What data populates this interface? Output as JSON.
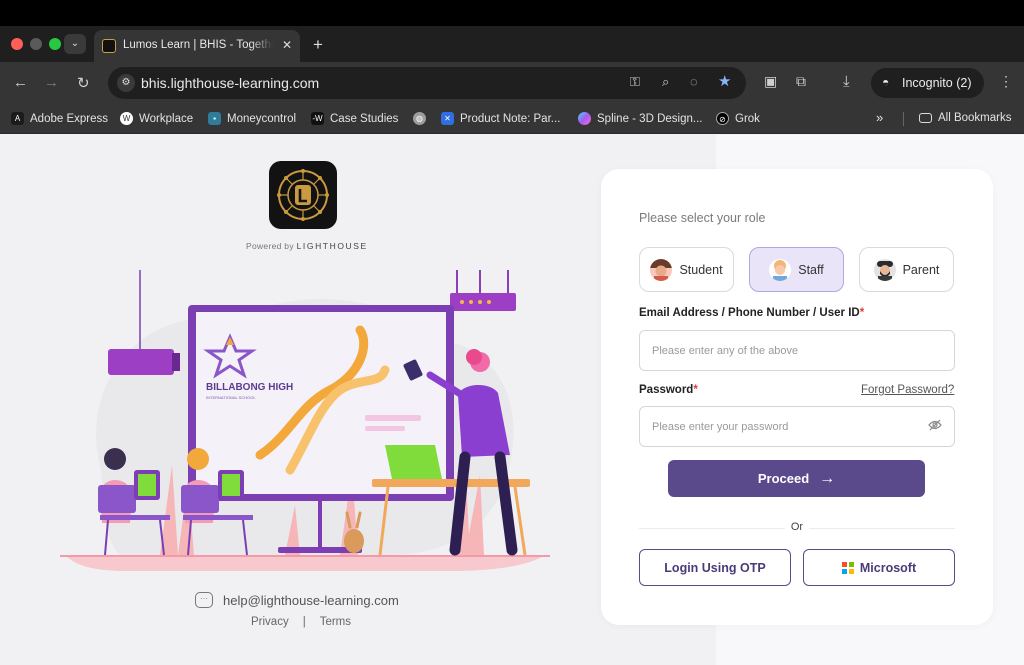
{
  "browser": {
    "tab_title": "Lumos Learn | BHIS - Together",
    "tab_close": "✕",
    "new_tab": "+",
    "url": "bhis.lighthouse-learning.com",
    "incognito_label": "Incognito (2)",
    "bookmarks": [
      {
        "label": "Adobe Express",
        "icon": "adobe-express-icon",
        "color": "#1b1b1b"
      },
      {
        "label": "Workplace",
        "icon": "workplace-icon",
        "color": "#ffffff"
      },
      {
        "label": "Moneycontrol",
        "icon": "moneycontrol-icon",
        "color": "#2e7d9a"
      },
      {
        "label": "Case Studies",
        "icon": "case-studies-icon",
        "color": "#111111"
      },
      {
        "label": "",
        "icon": "globe-icon",
        "color": "#9e9e9e"
      },
      {
        "label": "Product Note: Par...",
        "icon": "confluence-icon",
        "color": "#2f6fe4"
      },
      {
        "label": "Spline - 3D Design...",
        "icon": "spline-icon",
        "color": "#a35cf0"
      },
      {
        "label": "Grok",
        "icon": "grok-icon",
        "color": "#000000"
      }
    ],
    "all_bookmarks": "All Bookmarks",
    "overflow": "»"
  },
  "left": {
    "powered_prefix": "Powered by",
    "powered_brand": "LIGHTHOUSE",
    "board_logo_title": "BILLABONG HIGH",
    "board_logo_sub": "INTERNATIONAL SCHOOL",
    "help_email": "help@lighthouse-learning.com",
    "privacy": "Privacy",
    "separator": "|",
    "terms": "Terms"
  },
  "login": {
    "role_title": "Please select your role",
    "roles": [
      {
        "label": "Student",
        "active": false
      },
      {
        "label": "Staff",
        "active": true
      },
      {
        "label": "Parent",
        "active": false
      }
    ],
    "email_label": "Email Address / Phone Number / User ID",
    "required_mark": "*",
    "email_placeholder": "Please enter any of the above",
    "password_label": "Password",
    "password_placeholder": "Please enter your password",
    "forgot": "Forgot Password?",
    "proceed": "Proceed",
    "proceed_arrow": "→",
    "or": "Or",
    "otp": "Login Using OTP",
    "microsoft": "Microsoft"
  },
  "colors": {
    "primary": "#5b4a8b",
    "active_role_bg": "#e9e4f7",
    "required": "#e53935"
  }
}
